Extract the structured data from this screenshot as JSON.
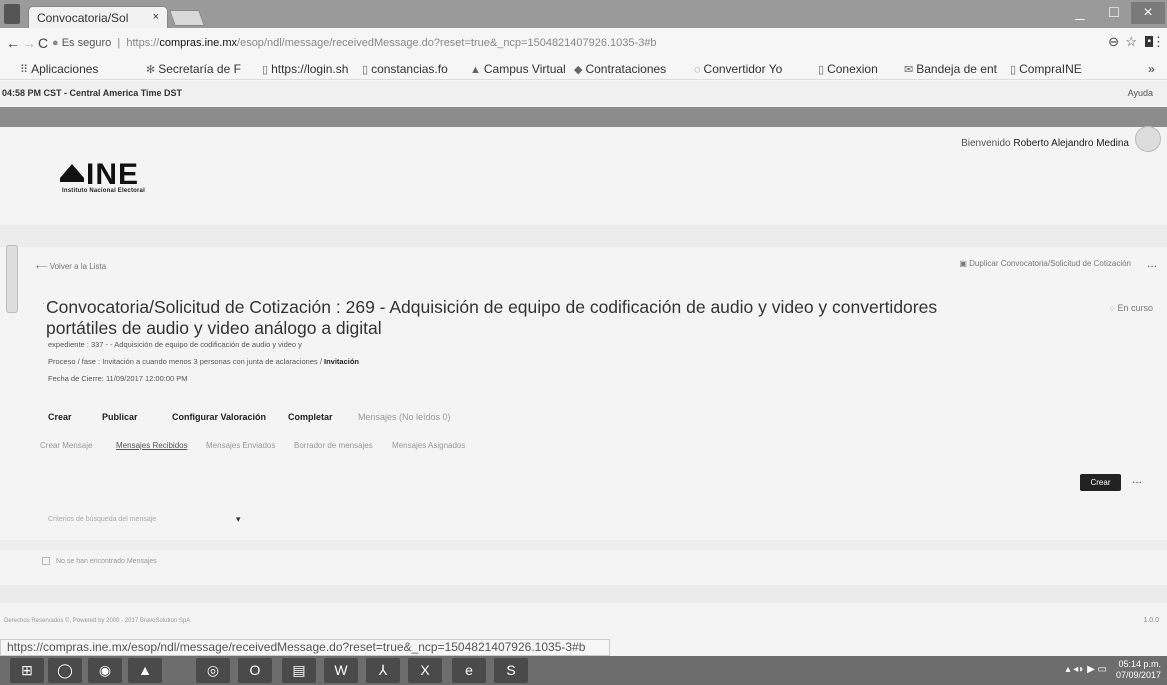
{
  "browser": {
    "tab_title": "Convocatoria/Sol",
    "tab_close": "×",
    "security_label": "Es seguro",
    "url_prefix": "https://",
    "url_host": "compras.ine.mx",
    "url_rest": "/esop/ndl/message/receivedMessage.do?reset=true&_ncp=1504821407926.1035-3#b",
    "nav_back": "←",
    "nav_forward": "→",
    "nav_reload": "C",
    "win_minimize": "_",
    "win_maximize": "□",
    "win_close": "×"
  },
  "bookmarks": [
    {
      "label": "Aplicaciones",
      "icon": "apps-icon",
      "glyph": "⠿"
    },
    {
      "label": "Secretaría de F",
      "icon": "seal-icon",
      "glyph": "✻"
    },
    {
      "label": "https://login.sh",
      "icon": "page-icon",
      "glyph": "▯"
    },
    {
      "label": "constancias.fo",
      "icon": "page-icon",
      "glyph": "▯"
    },
    {
      "label": "Campus Virtual",
      "icon": "campus-icon",
      "glyph": "▲"
    },
    {
      "label": "Contrataciones",
      "icon": "ine-icon",
      "glyph": "◆"
    },
    {
      "label": "Convertidor Yo",
      "icon": "convert-icon",
      "glyph": "◌"
    },
    {
      "label": "Conexion",
      "icon": "page-icon",
      "glyph": "▯"
    },
    {
      "label": "Bandeja de ent",
      "icon": "mail-icon",
      "glyph": "✉"
    },
    {
      "label": "CompraINE",
      "icon": "page-icon",
      "glyph": "▯"
    }
  ],
  "bookmarks_more": "»",
  "timebar": {
    "time": "04:58 PM CST - Central America Time DST",
    "help": "Ayuda"
  },
  "header": {
    "welcome_prefix": "Bienvenido",
    "user_name": "Roberto Alejandro Medina",
    "logo_word": "INE",
    "logo_sub": "Instituto Nacional Electoral"
  },
  "main": {
    "back_link": "Volver a la Lista",
    "copy_link": "Duplicar Convocatoria/Solicitud de Cotización",
    "more": "...",
    "title": "Convocatoria/Solicitud de Cotización : 269 - Adquisición de equipo de codificación de audio y video y convertidores portátiles de audio y video análogo a digital",
    "status": "En curso",
    "meta": [
      {
        "text": "expediente : 337 - - Adquisición de equipo de codificación de audio y video y"
      },
      {
        "text": "Proceso / fase : Invitación a cuando menos 3 personas con junta de aclaraciones / ",
        "bold": "Invitación"
      },
      {
        "text": "Fecha de Cierre: 11/09/2017 12:00:00 PM"
      }
    ],
    "tabs": [
      {
        "label": "Crear",
        "dim": false
      },
      {
        "label": "Publicar",
        "dim": false
      },
      {
        "label": "Configurar Valoración",
        "dim": false
      },
      {
        "label": "Completar",
        "dim": false
      },
      {
        "label": "Mensajes (No leídos 0)",
        "dim": true
      }
    ],
    "subtabs": [
      {
        "label": "Crear Mensaje",
        "active": false
      },
      {
        "label": "Mensajes Recibidos",
        "active": true
      },
      {
        "label": "Mensajes Enviados",
        "active": false
      },
      {
        "label": "Borrador de mensajes",
        "active": false
      },
      {
        "label": "Mensajes Asignados",
        "active": false
      }
    ],
    "create_button": "Crear",
    "filter_label": "Criterios de búsqueda del mensaje",
    "filter_chevron": "▾",
    "empty_message": "No se han encontrado Mensajes",
    "footer": "Derechos Reservados ©, Powered by 2000 - 2017 BravoSolution SpA",
    "version": "1.0.0"
  },
  "status_url": "https://compras.ine.mx/esop/ndl/message/receivedMessage.do?reset=true&_ncp=1504821407926.1035-3#b",
  "taskbar": {
    "apps": [
      {
        "name": "start-button",
        "glyph": "⊞"
      },
      {
        "name": "cortana-icon",
        "glyph": "◯"
      },
      {
        "name": "browser-icon",
        "glyph": "◉"
      },
      {
        "name": "app-icon",
        "glyph": "▲"
      },
      {
        "name": "chrome-icon",
        "glyph": "◎"
      },
      {
        "name": "outlook-icon",
        "glyph": "O"
      },
      {
        "name": "folder-icon",
        "glyph": "▤"
      },
      {
        "name": "word-icon",
        "glyph": "W"
      },
      {
        "name": "pdf-icon",
        "glyph": "⅄"
      },
      {
        "name": "excel-icon",
        "glyph": "X"
      },
      {
        "name": "ie-icon",
        "glyph": "e"
      },
      {
        "name": "skype-icon",
        "glyph": "S"
      }
    ],
    "tray": "▴ ◂◗ ▶ ▭",
    "time": "05:14 p.m.",
    "date": "07/09/2017"
  }
}
